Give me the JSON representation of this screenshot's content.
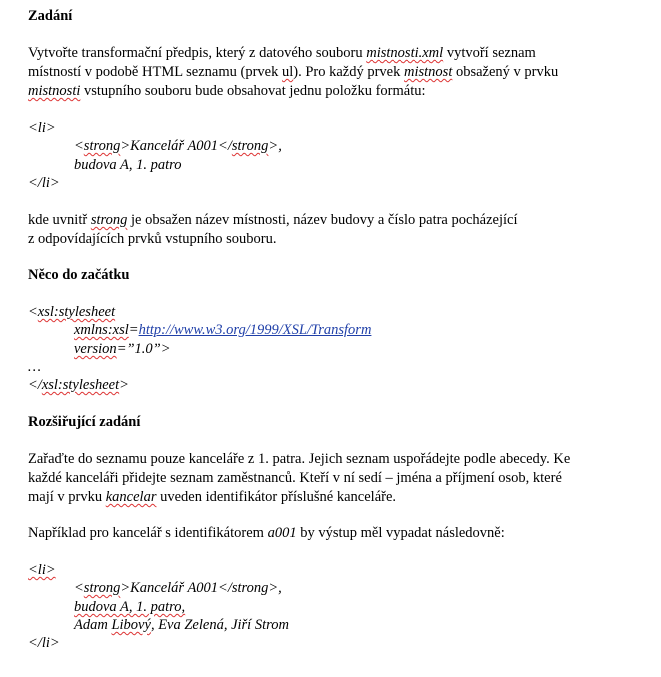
{
  "section1": {
    "heading": "Zadání",
    "p1": {
      "l1a": "Vytvořte transformační předpis, který z datového souboru ",
      "l1b": "mistnosti.xml",
      "l1c": " vytvoří seznam",
      "l2a": "místností v podobě HTML seznamu (prvek ",
      "l2b": "ul",
      "l2c": "). Pro každý prvek ",
      "l2d": "mistnost",
      "l2e": " obsažený v prvku",
      "l3a": "mistnosti",
      "l3b": " vstupního souboru bude obsahovat jednu položku formátu:"
    },
    "code": {
      "li_open": "<li>",
      "l2a": "<",
      "l2b": "strong",
      "l2c": ">Kancelář A001</",
      "l2d": "strong",
      "l2e": ">,",
      "l3": "budova A, 1. patro",
      "li_close": "</li>"
    },
    "p2": {
      "l1a": "kde uvnitř ",
      "l1b": "strong",
      "l1c": " je obsažen název místnosti, název budovy a číslo patra pocházející",
      "l2": "z odpovídajících prvků vstupního souboru."
    }
  },
  "section2": {
    "heading": "Něco do začátku",
    "code": {
      "l1a": "<",
      "l1b": "xsl:stylesheet",
      "l2a": "xmlns:xsl",
      "l2b": "=",
      "l2c": "http://www.w3.org/1999/XSL/Transform",
      "l3a": "version",
      "l3b": "=”1.0”>",
      "l4": "…",
      "l5a": "</",
      "l5b": "xsl:stylesheet",
      "l5c": ">"
    }
  },
  "section3": {
    "heading": "Rozšiřující zadání",
    "p1": {
      "l1": "Zařaďte do seznamu pouze kanceláře z 1. patra. Jejich seznam uspořádejte podle abecedy. Ke",
      "l2": "každé kanceláři přidejte seznam zaměstnanců. Kteří v ní sedí – jména a příjmení osob, které",
      "l3a": "mají v prvku ",
      "l3b": "kancelar",
      "l3c": " uveden identifikátor příslušné kanceláře."
    },
    "p2": {
      "a": "Například pro kancelář s identifikátorem ",
      "b": "a001",
      "c": " by výstup měl vypadat následovně:"
    },
    "code": {
      "li_open": "<li>",
      "l2a": "<",
      "l2b": "strong",
      "l2c": ">Kancelář A001</strong>,",
      "l3": "budova A, 1. patro,",
      "l4a": "Adam ",
      "l4b": "Libový",
      "l4c": ", Eva Zelená, Jiří Strom",
      "li_close": "</li>"
    }
  }
}
